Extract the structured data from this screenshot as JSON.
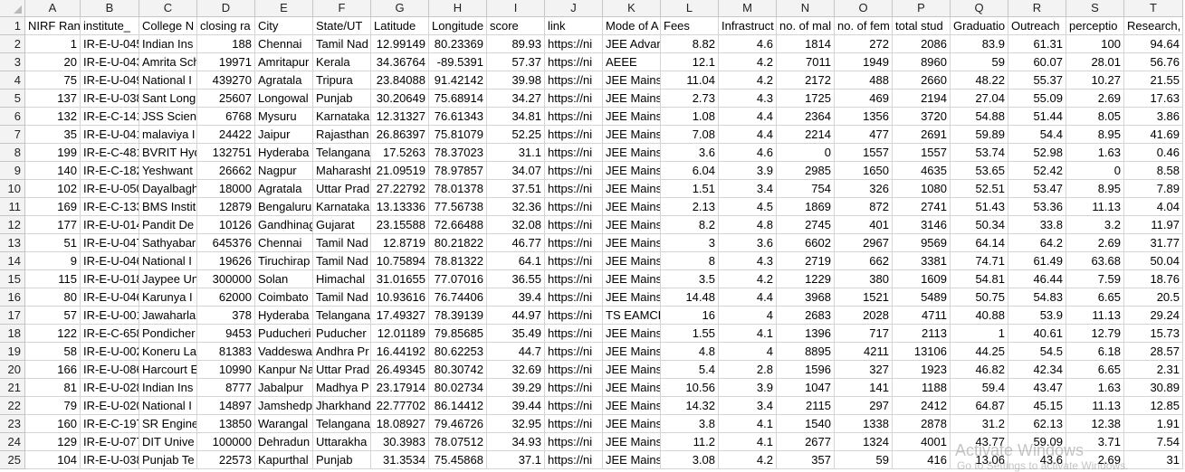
{
  "columns": [
    "A",
    "B",
    "C",
    "D",
    "E",
    "F",
    "G",
    "H",
    "I",
    "J",
    "K",
    "L",
    "M",
    "N",
    "O",
    "P",
    "Q",
    "R",
    "S",
    "T"
  ],
  "rows": [
    {
      "n": "1",
      "cells": [
        "NIRF Rank",
        "institute_",
        "College N",
        "closing ra",
        "City",
        "State/UT",
        "Latitude",
        "Longitude",
        "score",
        "link",
        "Mode of A",
        "Fees",
        "Infrastruct",
        "no. of mal",
        "no. of fem",
        "total stud",
        "Graduatio",
        "Outreach",
        "perceptio",
        "Research, t"
      ]
    },
    {
      "n": "2",
      "cells": [
        "1",
        "IR-E-U-045",
        "Indian Ins",
        "188",
        "Chennai",
        "Tamil Nad",
        "12.99149",
        "80.23369",
        "89.93",
        "https://ni",
        "JEE Advan",
        "8.82",
        "4.6",
        "1814",
        "272",
        "2086",
        "83.9",
        "61.31",
        "100",
        "94.64"
      ]
    },
    {
      "n": "3",
      "cells": [
        "20",
        "IR-E-U-043",
        "Amrita Sch",
        "19971",
        "Amritapur",
        "Kerala",
        "34.36764",
        "-89.5391",
        "57.37",
        "https://ni",
        "AEEE",
        "12.1",
        "4.2",
        "7011",
        "1949",
        "8960",
        "59",
        "60.07",
        "28.01",
        "56.76"
      ]
    },
    {
      "n": "4",
      "cells": [
        "75",
        "IR-E-U-049",
        "National I",
        "439270",
        "Agratala",
        "Tripura",
        "23.84088",
        "91.42142",
        "39.98",
        "https://ni",
        "JEE Mains",
        "11.04",
        "4.2",
        "2172",
        "488",
        "2660",
        "48.22",
        "55.37",
        "10.27",
        "21.55"
      ]
    },
    {
      "n": "5",
      "cells": [
        "137",
        "IR-E-U-038",
        "Sant Long",
        "25607",
        "Longowal",
        "Punjab",
        "30.20649",
        "75.68914",
        "34.27",
        "https://ni",
        "JEE Mains",
        "2.73",
        "4.3",
        "1725",
        "469",
        "2194",
        "27.04",
        "55.09",
        "2.69",
        "17.63"
      ]
    },
    {
      "n": "6",
      "cells": [
        "132",
        "IR-E-C-141",
        "JSS Scienc",
        "6768",
        "Mysuru",
        "Karnataka",
        "12.31327",
        "76.61343",
        "34.81",
        "https://ni",
        "JEE Mains",
        "1.08",
        "4.4",
        "2364",
        "1356",
        "3720",
        "54.88",
        "51.44",
        "8.05",
        "3.86"
      ]
    },
    {
      "n": "7",
      "cells": [
        "35",
        "IR-E-U-041",
        "malaviya I",
        "24422",
        "Jaipur",
        "Rajasthan",
        "26.86397",
        "75.81079",
        "52.25",
        "https://ni",
        "JEE Mains",
        "7.08",
        "4.4",
        "2214",
        "477",
        "2691",
        "59.89",
        "54.4",
        "8.95",
        "41.69"
      ]
    },
    {
      "n": "8",
      "cells": [
        "199",
        "IR-E-C-481",
        "BVRIT Hyd",
        "132751",
        "Hyderaba",
        "Telangana",
        "17.5263",
        "78.37023",
        "31.1",
        "https://ni",
        "JEE Mains",
        "3.6",
        "4.6",
        "0",
        "1557",
        "1557",
        "53.74",
        "52.98",
        "1.63",
        "0.46"
      ]
    },
    {
      "n": "9",
      "cells": [
        "140",
        "IR-E-C-182",
        "Yeshwant",
        "26662",
        "Nagpur",
        "Maharasht",
        "21.09519",
        "78.97857",
        "34.07",
        "https://ni",
        "JEE Mains",
        "6.04",
        "3.9",
        "2985",
        "1650",
        "4635",
        "53.65",
        "52.42",
        "0",
        "8.58"
      ]
    },
    {
      "n": "10",
      "cells": [
        "102",
        "IR-E-U-050",
        "Dayalbagh",
        "18000",
        "Agratala",
        "Uttar Prad",
        "27.22792",
        "78.01378",
        "37.51",
        "https://ni",
        "JEE Mains",
        "1.51",
        "3.4",
        "754",
        "326",
        "1080",
        "52.51",
        "53.47",
        "8.95",
        "7.89"
      ]
    },
    {
      "n": "11",
      "cells": [
        "169",
        "IR-E-C-133",
        "BMS Instit",
        "12879",
        "Bengaluru",
        "Karnataka",
        "13.13336",
        "77.56738",
        "32.36",
        "https://ni",
        "JEE Mains",
        "2.13",
        "4.5",
        "1869",
        "872",
        "2741",
        "51.43",
        "53.36",
        "11.13",
        "4.04"
      ]
    },
    {
      "n": "12",
      "cells": [
        "177",
        "IR-E-U-014",
        "Pandit De",
        "10126",
        "Gandhinag",
        "Gujarat",
        "23.15588",
        "72.66488",
        "32.08",
        "https://ni",
        "JEE Mains",
        "8.2",
        "4.8",
        "2745",
        "401",
        "3146",
        "50.34",
        "33.8",
        "3.2",
        "11.97"
      ]
    },
    {
      "n": "13",
      "cells": [
        "51",
        "IR-E-U-047",
        "Sathyabar",
        "645376",
        "Chennai",
        "Tamil Nad",
        "12.8719",
        "80.21822",
        "46.77",
        "https://ni",
        "JEE Mains",
        "3",
        "3.6",
        "6602",
        "2967",
        "9569",
        "64.14",
        "64.2",
        "2.69",
        "31.77"
      ]
    },
    {
      "n": "14",
      "cells": [
        "9",
        "IR-E-U-046",
        "National I",
        "19626",
        "Tiruchirap",
        "Tamil Nad",
        "10.75894",
        "78.81322",
        "64.1",
        "https://ni",
        "JEE Mains",
        "8",
        "4.3",
        "2719",
        "662",
        "3381",
        "74.71",
        "61.49",
        "63.68",
        "50.04"
      ]
    },
    {
      "n": "15",
      "cells": [
        "115",
        "IR-E-U-018",
        "Jaypee Un",
        "300000",
        "Solan",
        "Himachal",
        "31.01655",
        "77.07016",
        "36.55",
        "https://ni",
        "JEE Mains",
        "3.5",
        "4.2",
        "1229",
        "380",
        "1609",
        "54.81",
        "46.44",
        "7.59",
        "18.76"
      ]
    },
    {
      "n": "16",
      "cells": [
        "80",
        "IR-E-U-046",
        "Karunya I",
        "62000",
        "Coimbato",
        "Tamil Nad",
        "10.93616",
        "76.74406",
        "39.4",
        "https://ni",
        "JEE Mains",
        "14.48",
        "4.4",
        "3968",
        "1521",
        "5489",
        "50.75",
        "54.83",
        "6.65",
        "20.5"
      ]
    },
    {
      "n": "17",
      "cells": [
        "57",
        "IR-E-U-001",
        "Jawaharla",
        "378",
        "Hyderaba",
        "Telangana",
        "17.49327",
        "78.39139",
        "44.97",
        "https://ni",
        "TS EAMCE",
        "16",
        "4",
        "2683",
        "2028",
        "4711",
        "40.88",
        "53.9",
        "11.13",
        "29.24"
      ]
    },
    {
      "n": "18",
      "cells": [
        "122",
        "IR-E-C-658",
        "Pondicher",
        "9453",
        "Puducheri",
        "Puducher",
        "12.01189",
        "79.85685",
        "35.49",
        "https://ni",
        "JEE Mains",
        "1.55",
        "4.1",
        "1396",
        "717",
        "2113",
        "1",
        "40.61",
        "12.79",
        "15.73"
      ]
    },
    {
      "n": "19",
      "cells": [
        "58",
        "IR-E-U-002",
        "Koneru La",
        "81383",
        "Vaddeswa",
        "Andhra Pr",
        "16.44192",
        "80.62253",
        "44.7",
        "https://ni",
        "JEE Mains",
        "4.8",
        "4",
        "8895",
        "4211",
        "13106",
        "44.25",
        "54.5",
        "6.18",
        "28.57"
      ]
    },
    {
      "n": "20",
      "cells": [
        "166",
        "IR-E-U-086",
        "Harcourt E",
        "10990",
        "Kanpur Na",
        "Uttar Prad",
        "26.49345",
        "80.30742",
        "32.69",
        "https://ni",
        "JEE Mains",
        "5.4",
        "2.8",
        "1596",
        "327",
        "1923",
        "46.82",
        "42.34",
        "6.65",
        "2.31"
      ]
    },
    {
      "n": "21",
      "cells": [
        "81",
        "IR-E-U-028",
        "Indian Ins",
        "8777",
        "Jabalpur",
        "Madhya P",
        "23.17914",
        "80.02734",
        "39.29",
        "https://ni",
        "JEE Mains",
        "10.56",
        "3.9",
        "1047",
        "141",
        "1188",
        "59.4",
        "43.47",
        "1.63",
        "30.89"
      ]
    },
    {
      "n": "22",
      "cells": [
        "79",
        "IR-E-U-020",
        "National I",
        "14897",
        "Jamshedp",
        "Jharkhand",
        "22.77702",
        "86.14412",
        "39.44",
        "https://ni",
        "JEE Mains",
        "14.32",
        "3.4",
        "2115",
        "297",
        "2412",
        "64.87",
        "45.15",
        "11.13",
        "12.85"
      ]
    },
    {
      "n": "23",
      "cells": [
        "160",
        "IR-E-C-197",
        "SR Engine",
        "13850",
        "Warangal",
        "Telangana",
        "18.08927",
        "79.46726",
        "32.95",
        "https://ni",
        "JEE Mains",
        "3.8",
        "4.1",
        "1540",
        "1338",
        "2878",
        "31.2",
        "62.13",
        "12.38",
        "1.91"
      ]
    },
    {
      "n": "24",
      "cells": [
        "129",
        "IR-E-U-077",
        "DIT Unive",
        "100000",
        "Dehradun",
        "Uttarakha",
        "30.3983",
        "78.07512",
        "34.93",
        "https://ni",
        "JEE Mains",
        "11.2",
        "4.1",
        "2677",
        "1324",
        "4001",
        "43.77",
        "59.09",
        "3.71",
        "7.54"
      ]
    },
    {
      "n": "25",
      "cells": [
        "104",
        "IR-E-U-038",
        "Punjab Te",
        "22573",
        "Kapurthal",
        "Punjab",
        "31.3534",
        "75.45868",
        "37.1",
        "https://ni",
        "JEE Mains",
        "3.08",
        "4.2",
        "357",
        "59",
        "416",
        "13.06",
        "43.6",
        "2.69",
        "31"
      ]
    }
  ],
  "watermark": {
    "line1": "Activate Windows",
    "line2": "Go to Settings to activate Windows."
  },
  "colors": {
    "header_bg": "#f3f3f3",
    "gridline": "#d4d4d4",
    "watermark": "#969696"
  }
}
